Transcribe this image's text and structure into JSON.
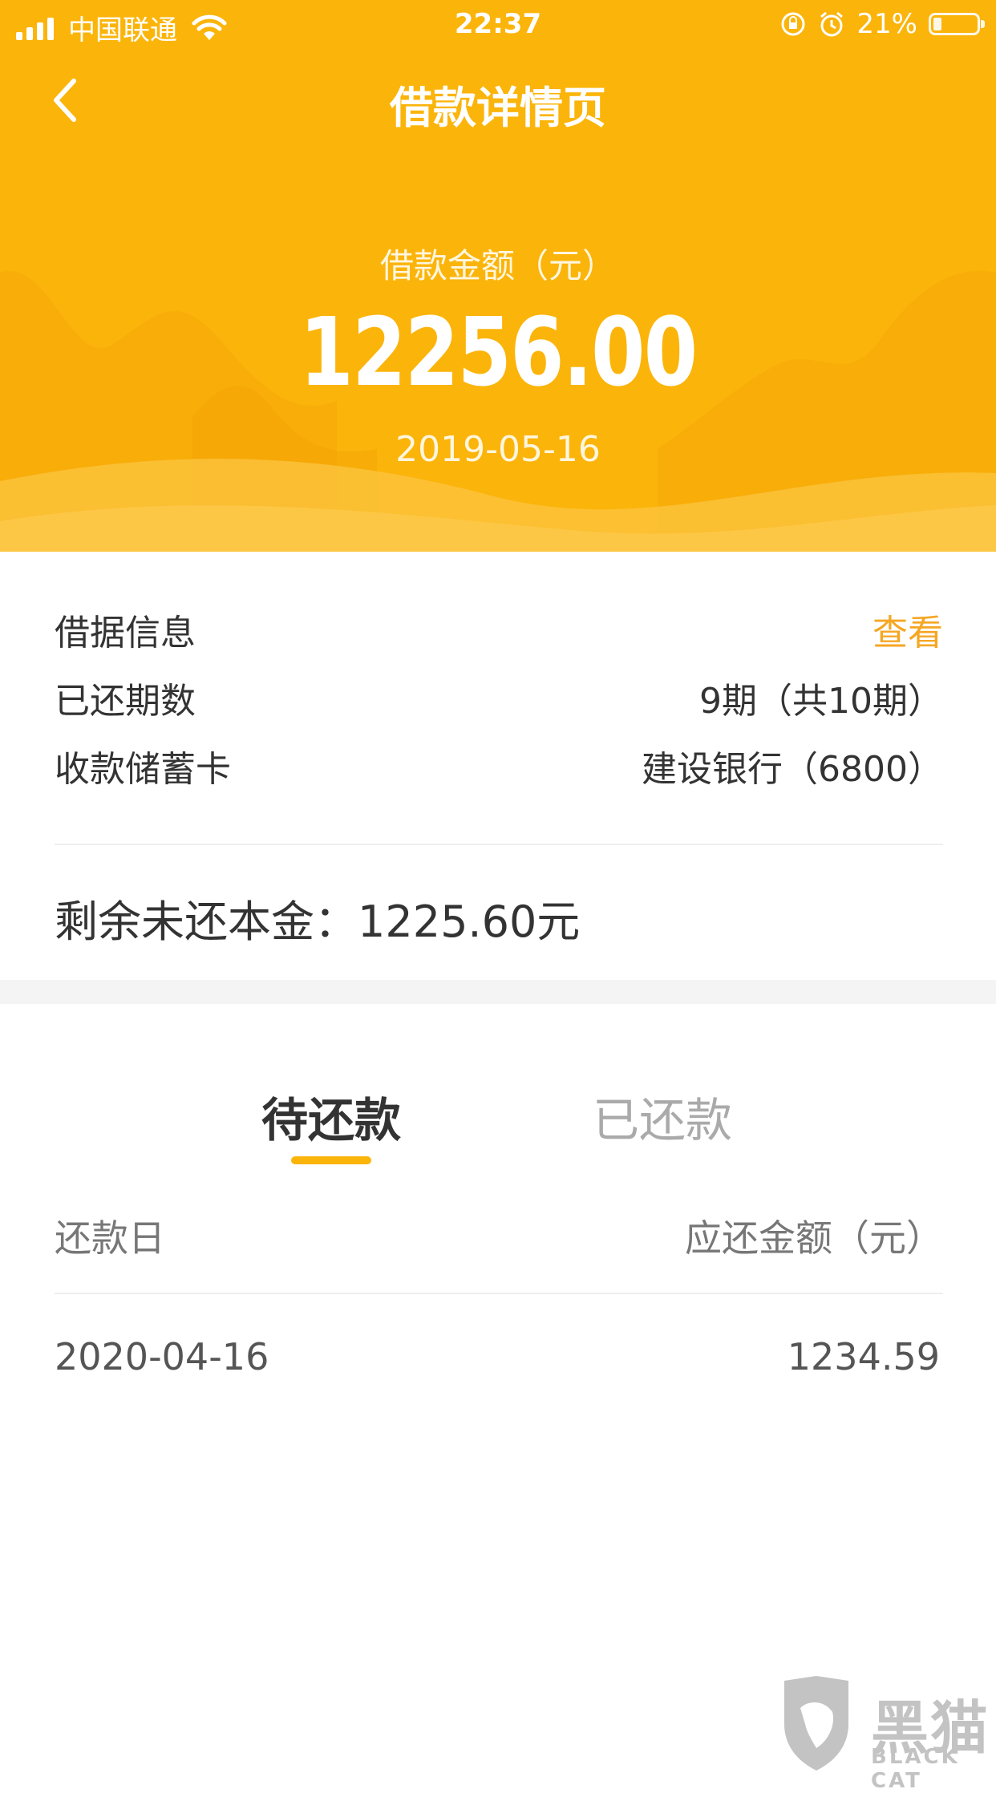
{
  "status_bar": {
    "carrier": "中国联通",
    "time": "22:37",
    "battery": "21%"
  },
  "nav": {
    "title": "借款详情页"
  },
  "summary": {
    "amount_label": "借款金额（元）",
    "amount": "12256.00",
    "date": "2019-05-16"
  },
  "info": {
    "rows": [
      {
        "label": "借据信息",
        "value": "查看"
      },
      {
        "label": "已还期数",
        "value": "9期（共10期）"
      },
      {
        "label": "收款储蓄卡",
        "value": "建设银行（6800）"
      }
    ],
    "remaining": "剩余未还本金：1225.60元"
  },
  "tabs": [
    {
      "label": "待还款",
      "active": true
    },
    {
      "label": "已还款",
      "active": false
    }
  ],
  "list": {
    "headers": {
      "date": "还款日",
      "amount": "应还金额（元）"
    },
    "rows": [
      {
        "date": "2020-04-16",
        "amount": "1234.59"
      }
    ]
  },
  "watermark": {
    "cn": "黑猫",
    "en": "BLACK CAT"
  },
  "colors": {
    "brand": "#fbb40a",
    "link": "#f5a623"
  },
  "icons": [
    "back-icon",
    "signal-icon",
    "wifi-icon",
    "rotation-lock-icon",
    "alarm-icon",
    "battery-icon",
    "black-cat-logo-icon"
  ]
}
